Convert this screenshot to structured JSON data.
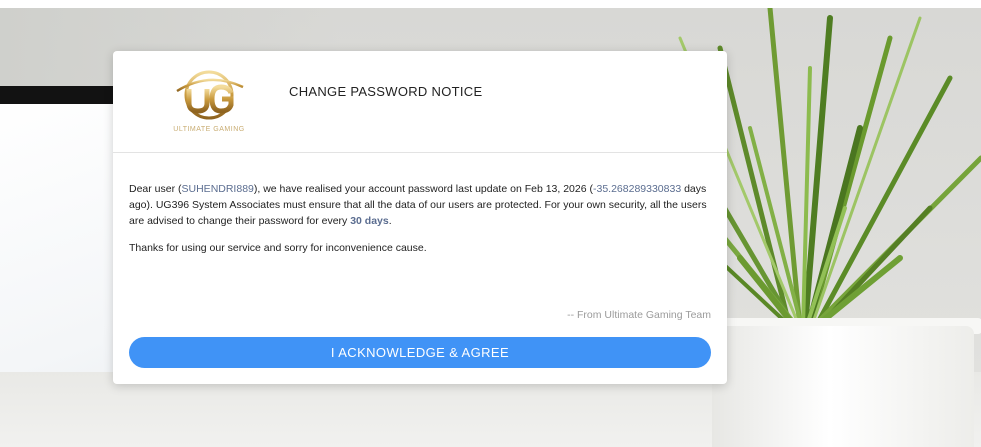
{
  "dialog": {
    "logo": {
      "monogram": "UG",
      "caption": "ULTIMATE GAMING"
    },
    "title": "CHANGE PASSWORD NOTICE",
    "message": {
      "p1_prefix": "Dear user (",
      "username": "SUHENDRI889",
      "p1_mid1": "), we have realised your account password last update on Feb 13, 2026 (",
      "days_ago": "-35.268289330833",
      "p1_mid2": " days ago). UG396 System Associates must ensure that all the data of our users are protected. For your own security, all the users are advised to change their password for every ",
      "interval": "30 days",
      "p1_suffix": ".",
      "p2": "Thanks for using our service and sorry for inconvenience cause."
    },
    "signature": "-- From Ultimate Gaming Team",
    "acknowledge_label": "I ACKNOWLEDGE & AGREE"
  },
  "colors": {
    "accent_button": "#4093f6",
    "highlight_text": "#5b6d90",
    "logo_gold": "#c9ad73"
  }
}
